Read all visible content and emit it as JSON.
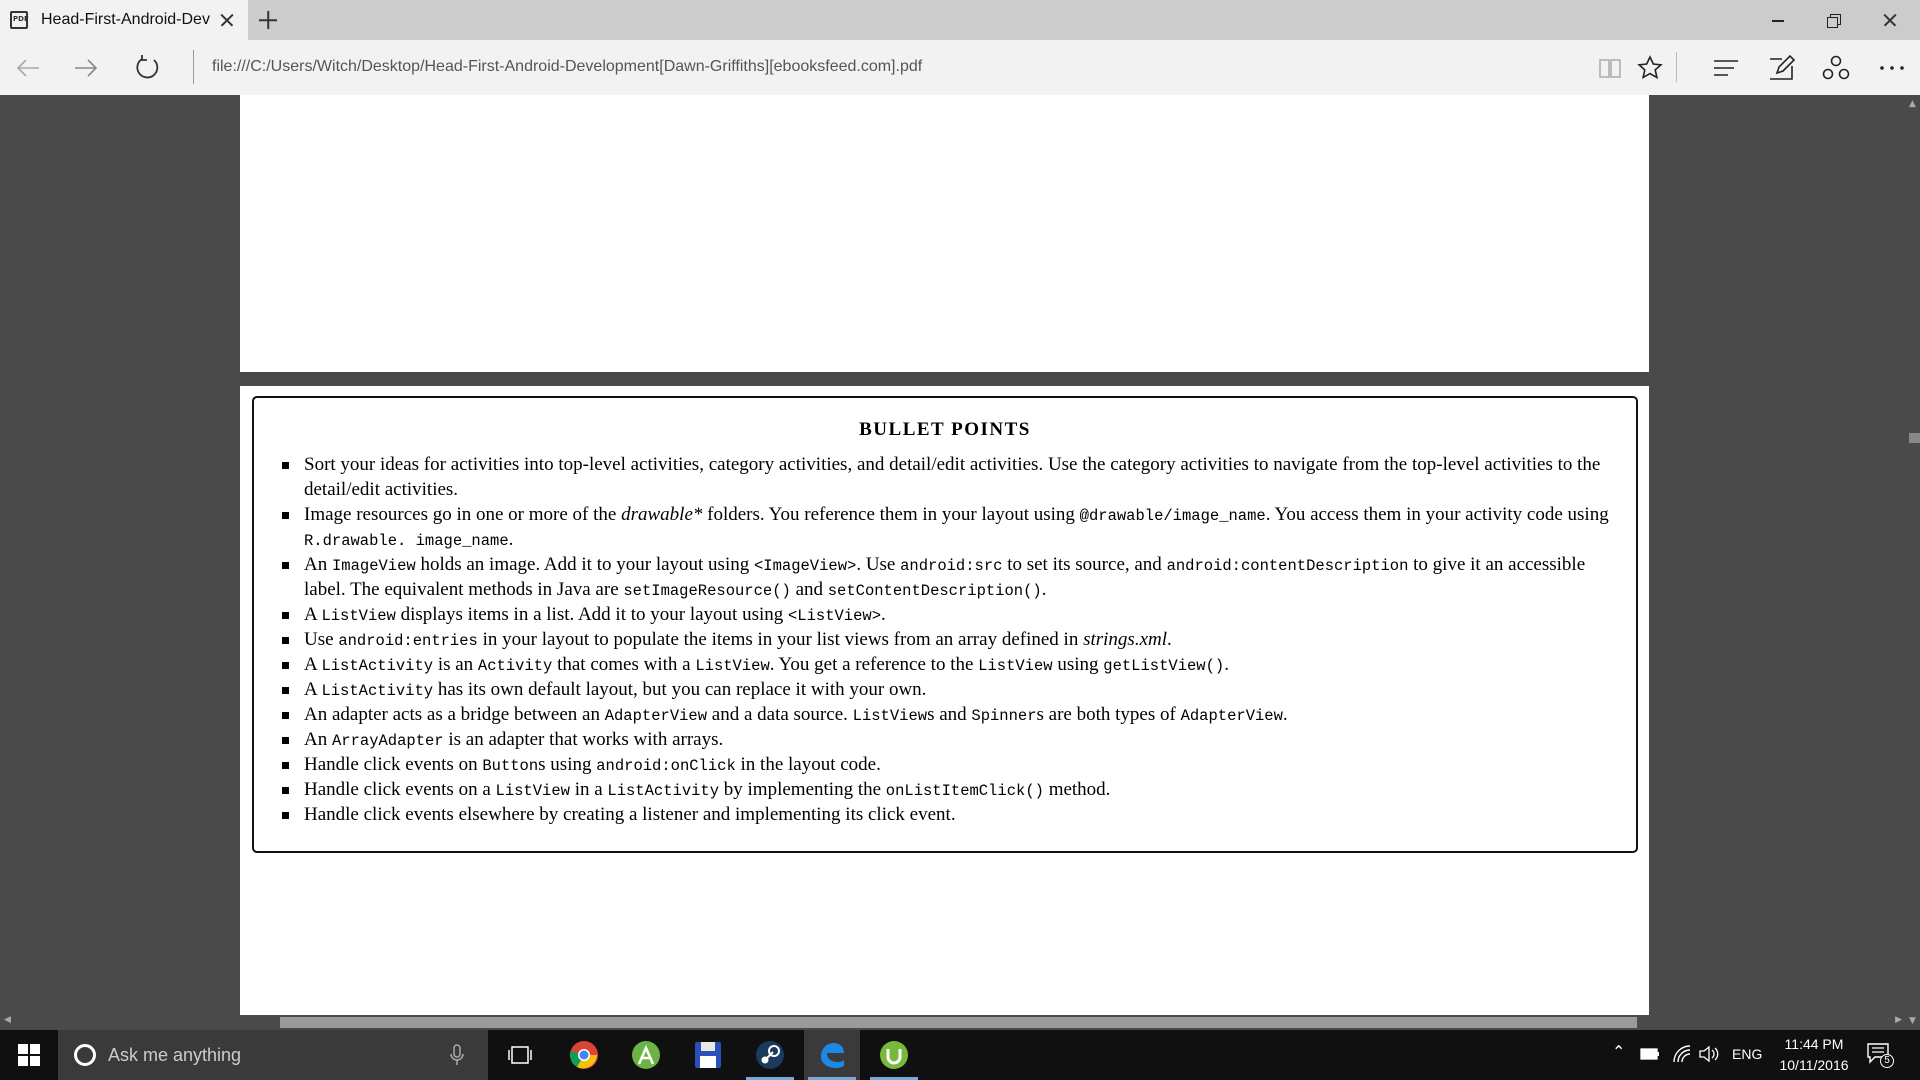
{
  "browser": {
    "tab_title": "Head-First-Android-Dev",
    "url": "file:///C:/Users/Witch/Desktop/Head-First-Android-Development[Dawn-Griffiths][ebooksfeed.com].pdf",
    "favicon_label": "PDF"
  },
  "document": {
    "box_title": "BULLET POINTS",
    "bullets": [
      [
        {
          "t": "Sort your ideas for activities into top-level activities, category activities, and detail/edit activities. Use the category activities to navigate from the top-level activities to the detail/edit activities."
        }
      ],
      [
        {
          "t": "Image resources go in one or more of the "
        },
        {
          "t": "drawable*",
          "s": "em"
        },
        {
          "t": " folders. You reference them in your layout using "
        },
        {
          "t": "@drawable/image_name",
          "s": "code"
        },
        {
          "t": ". You access them in your activity code using "
        },
        {
          "t": "R.drawable. image_name",
          "s": "code"
        },
        {
          "t": "."
        }
      ],
      [
        {
          "t": "An "
        },
        {
          "t": "ImageView",
          "s": "code"
        },
        {
          "t": " holds an image. Add it to your layout using "
        },
        {
          "t": "<ImageView>",
          "s": "code"
        },
        {
          "t": ". Use "
        },
        {
          "t": "android:src",
          "s": "code"
        },
        {
          "t": " to set its source, and "
        },
        {
          "t": "android:contentDescription",
          "s": "code"
        },
        {
          "t": " to give it an accessible label. The equivalent methods in Java are "
        },
        {
          "t": "setImageResource()",
          "s": "code"
        },
        {
          "t": " and "
        },
        {
          "t": "setContentDescription()",
          "s": "code"
        },
        {
          "t": "."
        }
      ],
      [
        {
          "t": "A "
        },
        {
          "t": "ListView",
          "s": "code"
        },
        {
          "t": " displays items in a list. Add it to your layout using "
        },
        {
          "t": "<ListView>",
          "s": "code"
        },
        {
          "t": "."
        }
      ],
      [
        {
          "t": "Use "
        },
        {
          "t": "android:entries",
          "s": "code"
        },
        {
          "t": " in your layout to populate the items in your list views from an array defined in "
        },
        {
          "t": "strings.xml",
          "s": "em"
        },
        {
          "t": "."
        }
      ],
      [
        {
          "t": "A "
        },
        {
          "t": "ListActivity",
          "s": "code"
        },
        {
          "t": " is an "
        },
        {
          "t": "Activity",
          "s": "code"
        },
        {
          "t": " that comes with a "
        },
        {
          "t": "ListView",
          "s": "code"
        },
        {
          "t": ". You get a reference to the "
        },
        {
          "t": "ListView",
          "s": "code"
        },
        {
          "t": " using "
        },
        {
          "t": "getListView()",
          "s": "code"
        },
        {
          "t": "."
        }
      ],
      [
        {
          "t": "A "
        },
        {
          "t": "ListActivity",
          "s": "code"
        },
        {
          "t": " has its own default layout, but you can replace it with your own."
        }
      ],
      [
        {
          "t": "An adapter acts as a bridge between an "
        },
        {
          "t": "AdapterView",
          "s": "code"
        },
        {
          "t": " and a data source. "
        },
        {
          "t": "ListView",
          "s": "code"
        },
        {
          "t": "s and "
        },
        {
          "t": "Spinner",
          "s": "code"
        },
        {
          "t": "s are both types of "
        },
        {
          "t": "AdapterView",
          "s": "code"
        },
        {
          "t": "."
        }
      ],
      [
        {
          "t": "An "
        },
        {
          "t": "ArrayAdapter",
          "s": "code"
        },
        {
          "t": " is an adapter that works with arrays."
        }
      ],
      [
        {
          "t": "Handle click events on "
        },
        {
          "t": "Button",
          "s": "code"
        },
        {
          "t": "s using "
        },
        {
          "t": "android:onClick",
          "s": "code"
        },
        {
          "t": " in the layout code."
        }
      ],
      [
        {
          "t": "Handle click events on a "
        },
        {
          "t": "ListView",
          "s": "code"
        },
        {
          "t": " in a "
        },
        {
          "t": "ListActivity",
          "s": "code"
        },
        {
          "t": " by implementing the "
        },
        {
          "t": "onListItemClick()",
          "s": "code"
        },
        {
          "t": " method."
        }
      ],
      [
        {
          "t": "Handle click events elsewhere by creating a listener and implementing its click event."
        }
      ]
    ]
  },
  "taskbar": {
    "search_placeholder": "Ask me anything",
    "apps": [
      "task-view",
      "chrome",
      "android-studio",
      "file-manager",
      "steam",
      "edge",
      "utorrent"
    ],
    "lang": "ENG",
    "time": "11:44 PM",
    "date": "10/11/2016",
    "notification_count": "5"
  },
  "colors": {
    "viewer_bg": "#4a4a4a",
    "tabbar_bg": "#cccccc",
    "taskbar_bg": "#101010",
    "accent": "#0078d7"
  }
}
